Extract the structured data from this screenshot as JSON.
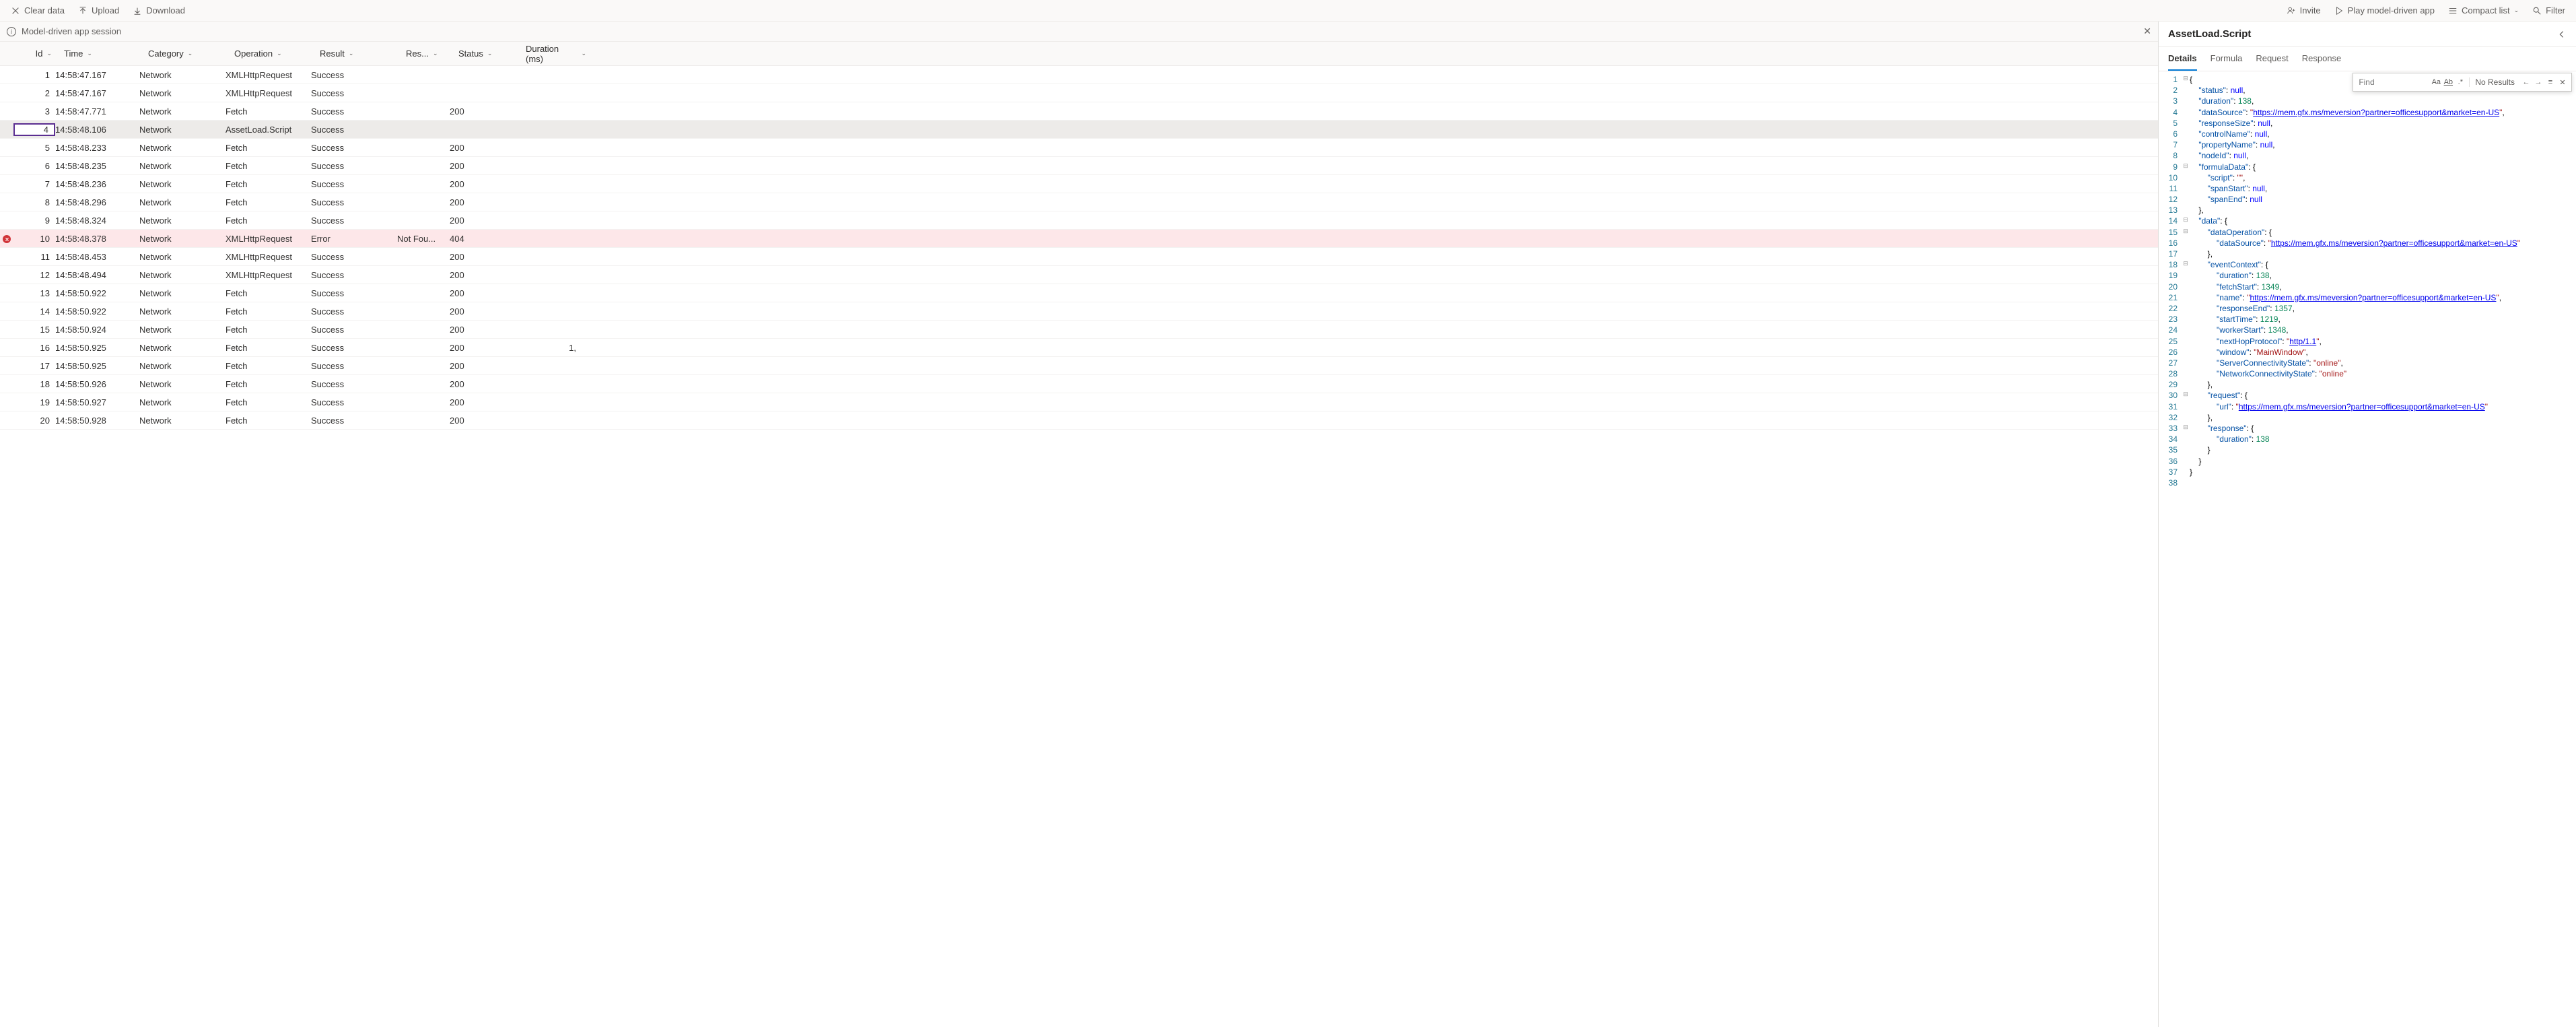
{
  "toolbar": {
    "clear": "Clear data",
    "upload": "Upload",
    "download": "Download",
    "invite": "Invite",
    "play": "Play model-driven app",
    "compact": "Compact list",
    "filter": "Filter"
  },
  "session": {
    "label": "Model-driven app session"
  },
  "columns": {
    "id": "Id",
    "time": "Time",
    "category": "Category",
    "operation": "Operation",
    "result": "Result",
    "reason": "Res...",
    "status": "Status",
    "duration": "Duration (ms)"
  },
  "rows": [
    {
      "id": "1",
      "time": "14:58:47.167",
      "cat": "Network",
      "op": "XMLHttpRequest",
      "res": "Success",
      "reason": "",
      "status": "",
      "dur": ""
    },
    {
      "id": "2",
      "time": "14:58:47.167",
      "cat": "Network",
      "op": "XMLHttpRequest",
      "res": "Success",
      "reason": "",
      "status": "",
      "dur": ""
    },
    {
      "id": "3",
      "time": "14:58:47.771",
      "cat": "Network",
      "op": "Fetch",
      "res": "Success",
      "reason": "",
      "status": "200",
      "dur": ""
    },
    {
      "id": "4",
      "time": "14:58:48.106",
      "cat": "Network",
      "op": "AssetLoad.Script",
      "res": "Success",
      "reason": "",
      "status": "",
      "dur": "",
      "selected": true
    },
    {
      "id": "5",
      "time": "14:58:48.233",
      "cat": "Network",
      "op": "Fetch",
      "res": "Success",
      "reason": "",
      "status": "200",
      "dur": ""
    },
    {
      "id": "6",
      "time": "14:58:48.235",
      "cat": "Network",
      "op": "Fetch",
      "res": "Success",
      "reason": "",
      "status": "200",
      "dur": ""
    },
    {
      "id": "7",
      "time": "14:58:48.236",
      "cat": "Network",
      "op": "Fetch",
      "res": "Success",
      "reason": "",
      "status": "200",
      "dur": ""
    },
    {
      "id": "8",
      "time": "14:58:48.296",
      "cat": "Network",
      "op": "Fetch",
      "res": "Success",
      "reason": "",
      "status": "200",
      "dur": ""
    },
    {
      "id": "9",
      "time": "14:58:48.324",
      "cat": "Network",
      "op": "Fetch",
      "res": "Success",
      "reason": "",
      "status": "200",
      "dur": ""
    },
    {
      "id": "10",
      "time": "14:58:48.378",
      "cat": "Network",
      "op": "XMLHttpRequest",
      "res": "Error",
      "reason": "Not Fou...",
      "status": "404",
      "dur": "",
      "error": true
    },
    {
      "id": "11",
      "time": "14:58:48.453",
      "cat": "Network",
      "op": "XMLHttpRequest",
      "res": "Success",
      "reason": "",
      "status": "200",
      "dur": ""
    },
    {
      "id": "12",
      "time": "14:58:48.494",
      "cat": "Network",
      "op": "XMLHttpRequest",
      "res": "Success",
      "reason": "",
      "status": "200",
      "dur": ""
    },
    {
      "id": "13",
      "time": "14:58:50.922",
      "cat": "Network",
      "op": "Fetch",
      "res": "Success",
      "reason": "",
      "status": "200",
      "dur": ""
    },
    {
      "id": "14",
      "time": "14:58:50.922",
      "cat": "Network",
      "op": "Fetch",
      "res": "Success",
      "reason": "",
      "status": "200",
      "dur": ""
    },
    {
      "id": "15",
      "time": "14:58:50.924",
      "cat": "Network",
      "op": "Fetch",
      "res": "Success",
      "reason": "",
      "status": "200",
      "dur": ""
    },
    {
      "id": "16",
      "time": "14:58:50.925",
      "cat": "Network",
      "op": "Fetch",
      "res": "Success",
      "reason": "",
      "status": "200",
      "dur": "1,"
    },
    {
      "id": "17",
      "time": "14:58:50.925",
      "cat": "Network",
      "op": "Fetch",
      "res": "Success",
      "reason": "",
      "status": "200",
      "dur": ""
    },
    {
      "id": "18",
      "time": "14:58:50.926",
      "cat": "Network",
      "op": "Fetch",
      "res": "Success",
      "reason": "",
      "status": "200",
      "dur": ""
    },
    {
      "id": "19",
      "time": "14:58:50.927",
      "cat": "Network",
      "op": "Fetch",
      "res": "Success",
      "reason": "",
      "status": "200",
      "dur": ""
    },
    {
      "id": "20",
      "time": "14:58:50.928",
      "cat": "Network",
      "op": "Fetch",
      "res": "Success",
      "reason": "",
      "status": "200",
      "dur": ""
    }
  ],
  "details": {
    "title": "AssetLoad.Script",
    "tabs": {
      "details": "Details",
      "formula": "Formula",
      "request": "Request",
      "response": "Response"
    },
    "find": {
      "placeholder": "Find",
      "results": "No Results"
    },
    "json": {
      "status": null,
      "duration": 138,
      "dataSource": "https://mem.gfx.ms/meversion?partner=officesupport&market=en-US",
      "responseSize": null,
      "controlName": null,
      "propertyName": null,
      "nodeId": null,
      "formulaData": {
        "script": "",
        "spanStart": null,
        "spanEnd": null
      },
      "data": {
        "dataOperation": {
          "dataSource": "https://mem.gfx.ms/meversion?partner=officesupport&market=en-US"
        },
        "eventContext": {
          "duration": 138,
          "fetchStart": 1349,
          "name": "https://mem.gfx.ms/meversion?partner=officesupport&market=en-US",
          "responseEnd": 1357,
          "startTime": 1219,
          "workerStart": 1348,
          "nextHopProtocol": "http/1.1",
          "window": "MainWindow",
          "ServerConnectivityState": "online",
          "NetworkConnectivityState": "online"
        },
        "request": {
          "url": "https://mem.gfx.ms/meversion?partner=officesupport&market=en-US"
        },
        "response": {
          "duration": 138
        }
      }
    }
  }
}
